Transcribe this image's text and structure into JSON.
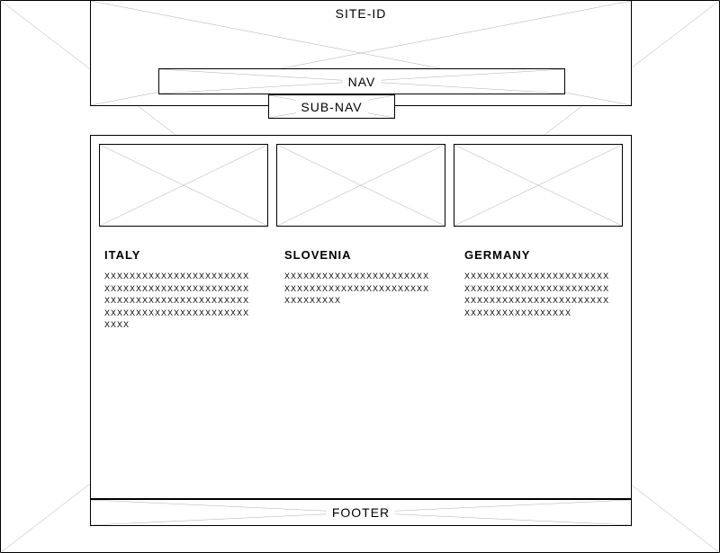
{
  "header": {
    "site_id": "SITE-ID",
    "nav_label": "NAV",
    "sub_nav_label": "SUB-NAV"
  },
  "columns": [
    {
      "title": "ITALY",
      "body": "XXXXXXXXXXXXXXXXXXXXXXX XXXXXXXXXXXXXXXXXXXXXXX XXXXXXXXXXXXXXXXXXXXXXX XXXXXXXXXXXXXXXXXXXXXXX XXXX"
    },
    {
      "title": "SLOVENIA",
      "body": "XXXXXXXXXXXXXXXXXXXXXXX XXXXXXXXXXXXXXXXXXXXXXX XXXXXXXXX"
    },
    {
      "title": "GERMANY",
      "body": "XXXXXXXXXXXXXXXXXXXXXXX XXXXXXXXXXXXXXXXXXXXXXX XXXXXXXXXXXXXXXXXXXXXXX XXXXXXXXXXXXXXXXX"
    }
  ],
  "footer": {
    "label": "FOOTER"
  }
}
